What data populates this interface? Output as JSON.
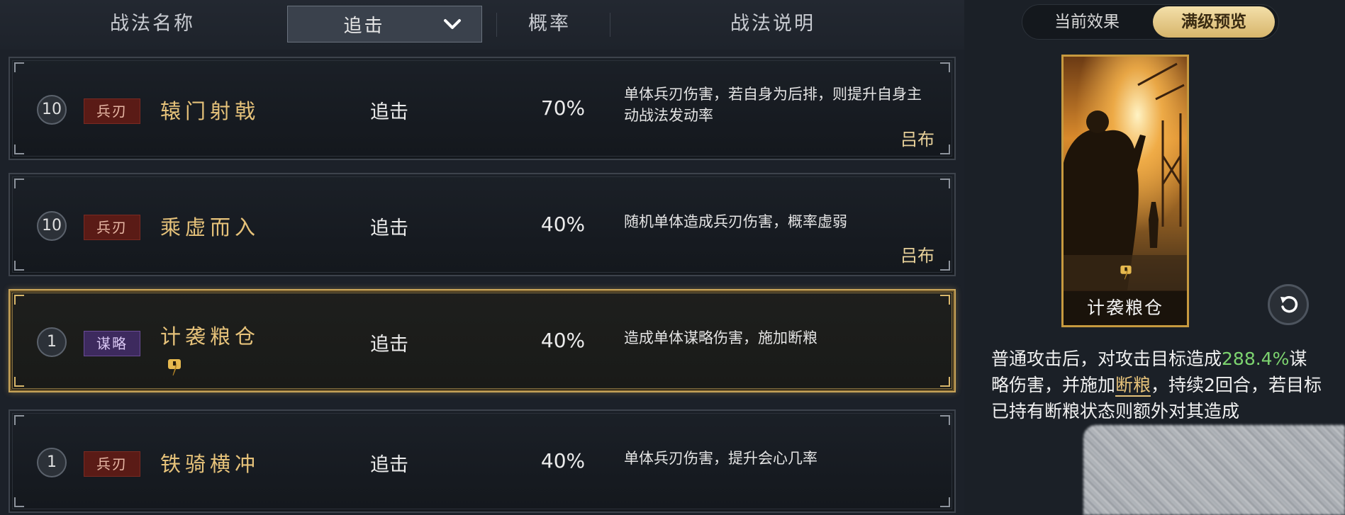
{
  "header": {
    "col_name": "战法名称",
    "filter_value": "追击",
    "col_prob": "概率",
    "col_desc": "战法说明"
  },
  "tactics": [
    {
      "level": "10",
      "tag": "兵刃",
      "name": "辕门射戟",
      "type": "追击",
      "prob": "70%",
      "desc": "单体兵刃伤害，若自身为后排，则提升自身主动战法发动率",
      "owner": "吕布"
    },
    {
      "level": "10",
      "tag": "兵刃",
      "name": "乘虚而入",
      "type": "追击",
      "prob": "40%",
      "desc": "随机单体造成兵刃伤害，概率虚弱",
      "owner": "吕布"
    },
    {
      "level": "1",
      "tag": "谋略",
      "name": "计袭粮仓",
      "type": "追击",
      "prob": "40%",
      "desc": "造成单体谋略伤害，施加断粮",
      "owner": ""
    },
    {
      "level": "1",
      "tag": "兵刃",
      "name": "铁骑横冲",
      "type": "追击",
      "prob": "40%",
      "desc": "单体兵刃伤害，提升会心几率",
      "owner": ""
    }
  ],
  "panel": {
    "tab_current": "当前效果",
    "tab_max": "满级预览",
    "card_name": "计袭粮仓",
    "effect": {
      "p1": "普通攻击后，对攻击目标造成",
      "value": "288.4%",
      "p2": "谋略伤害，并施加",
      "keyword": "断粮",
      "p3": "，持续2回合，若目标已持有断粮状态则额外对其造成"
    }
  },
  "icons": {
    "filter": "chevron-down-icon",
    "refresh": "refresh-icon",
    "owner_mark": "seal-mark-icon"
  },
  "colors": {
    "gold": "#e6c27a",
    "green": "#7cd36f",
    "selected_border": "#c9a55a"
  }
}
